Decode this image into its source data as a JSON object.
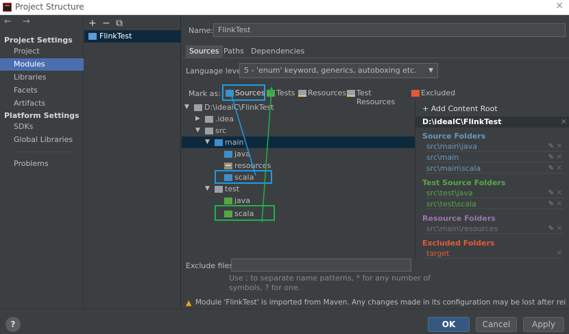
{
  "window": {
    "title": "Project Structure"
  },
  "sidebar": {
    "nav_arrows": "← →",
    "project_settings": "Project Settings",
    "items_project": [
      "Project",
      "Modules",
      "Libraries",
      "Facets",
      "Artifacts"
    ],
    "platform_settings": "Platform Settings",
    "items_platform": [
      "SDKs",
      "Global Libraries"
    ],
    "problems": "Problems",
    "selected": "Modules"
  },
  "module_list": {
    "toolbar": [
      "+",
      "−",
      "⧉"
    ],
    "modules": [
      "FlinkTest"
    ]
  },
  "module": {
    "name_label": "Name:",
    "name_value": "FlinkTest",
    "tabs": [
      "Sources",
      "Paths",
      "Dependencies"
    ],
    "active_tab": "Sources",
    "language_level_label": "Language level:",
    "language_level_value": "5 - 'enum' keyword, generics, autoboxing etc.",
    "mark_as_label": "Mark as:",
    "mark_as": [
      "Sources",
      "Tests",
      "Resources",
      "Test Resources",
      "Excluded"
    ]
  },
  "tree": [
    {
      "label": "D:\\idealC\\FlinkTest",
      "depth": 0,
      "arrow": "▼",
      "folder": "grey"
    },
    {
      "label": ".idea",
      "depth": 1,
      "arrow": "▶",
      "folder": "grey"
    },
    {
      "label": "src",
      "depth": 1,
      "arrow": "▼",
      "folder": "grey"
    },
    {
      "label": "main",
      "depth": 2,
      "arrow": "▼",
      "folder": "blue"
    },
    {
      "label": "java",
      "depth": 3,
      "arrow": "",
      "folder": "blue"
    },
    {
      "label": "resources",
      "depth": 3,
      "arrow": "",
      "folder": "res"
    },
    {
      "label": "scala",
      "depth": 3,
      "arrow": "",
      "folder": "blue"
    },
    {
      "label": "test",
      "depth": 2,
      "arrow": "▼",
      "folder": "grey"
    },
    {
      "label": "java",
      "depth": 3,
      "arrow": "",
      "folder": "green"
    },
    {
      "label": "scala",
      "depth": 3,
      "arrow": "",
      "folder": "green"
    }
  ],
  "roots": {
    "add_label": "+ Add Content Root",
    "root_path": "D:\\idealC\\FlinkTest",
    "source_folders_label": "Source Folders",
    "source_folders": [
      "src\\main\\java",
      "src\\main",
      "src\\main\\scala"
    ],
    "test_folders_label": "Test Source Folders",
    "test_folders": [
      "src\\test\\java",
      "src\\test\\scala"
    ],
    "resource_folders_label": "Resource Folders",
    "resource_folders": [
      "src\\main\\resources"
    ],
    "excluded_folders_label": "Excluded Folders",
    "excluded_folders": [
      "target"
    ]
  },
  "exclude": {
    "label": "Exclude files:",
    "value": "",
    "hint_line1": "Use ; to separate name patterns, * for any number of",
    "hint_line2": "symbols, ? for one."
  },
  "warning": "Module 'FlinkTest' is imported from Maven. Any changes made in its configuration may be lost after reimporting.",
  "buttons": {
    "help": "?",
    "ok": "OK",
    "cancel": "Cancel",
    "apply": "Apply"
  },
  "colors": {
    "source": "#3f8ecb",
    "test": "#57a64a",
    "resource": "#9876aa",
    "excluded": "#e05a3a",
    "highlight_blue": "#1e9be8",
    "highlight_green": "#22b14c"
  }
}
